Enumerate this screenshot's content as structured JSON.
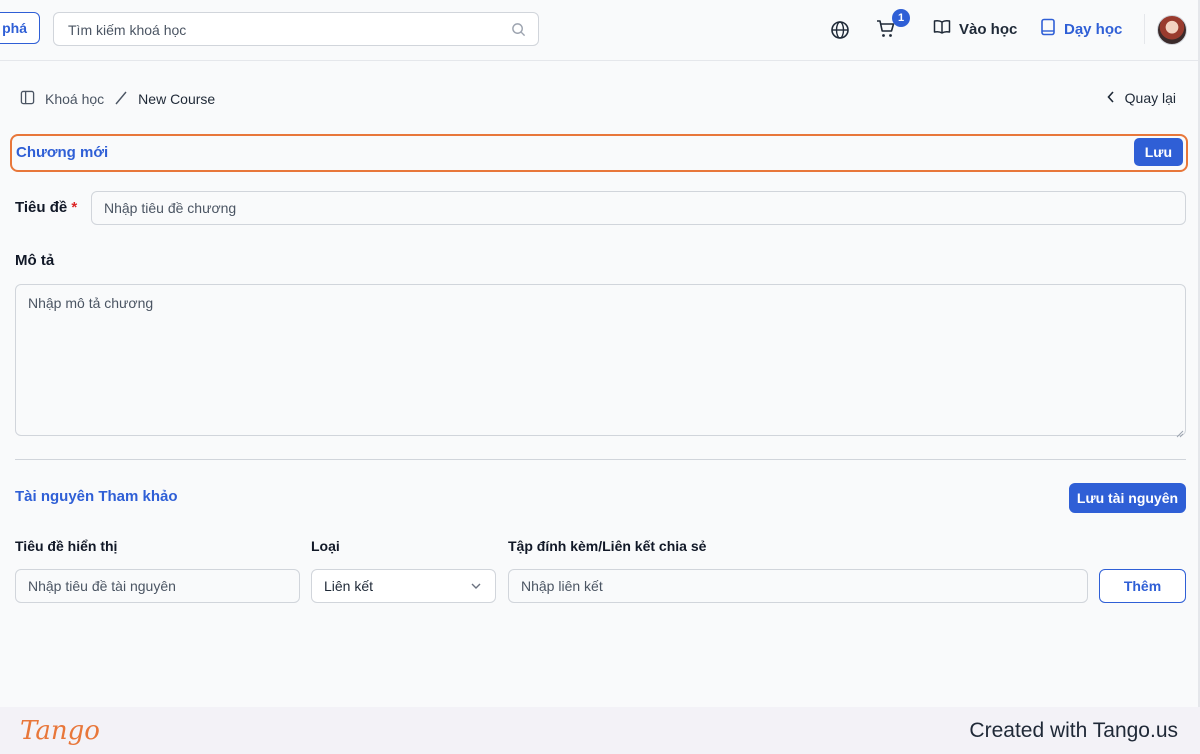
{
  "header": {
    "explore_label": "phá",
    "search_placeholder": "Tìm kiếm khoá học",
    "cart_count": "1",
    "learn_label": "Vào học",
    "teach_label": "Dạy học"
  },
  "breadcrumb": {
    "courses": "Khoá học",
    "current": "New Course",
    "back_label": "Quay lại"
  },
  "chapter": {
    "title": "Chương mới",
    "save_label": "Lưu",
    "title_label": "Tiêu đề",
    "required_mark": "*",
    "title_placeholder": "Nhập tiêu đề chương",
    "description_label": "Mô tả",
    "description_placeholder": "Nhập mô tả chương"
  },
  "resources": {
    "section_title": "Tài nguyên Tham khảo",
    "save_label": "Lưu tài nguyên",
    "col_display_title": "Tiêu đề hiển thị",
    "col_type": "Loại",
    "col_attachment": "Tập đính kèm/Liên kết chia sẻ",
    "display_title_placeholder": "Nhập tiêu đề tài nguyên",
    "type_selected": "Liên kết",
    "link_placeholder": "Nhập liên kết",
    "add_label": "Thêm"
  },
  "footer": {
    "logo_text": "Tango",
    "created_text": "Created with Tango.us"
  },
  "colors": {
    "primary": "#2f5fd6",
    "highlight": "#e8773a",
    "required": "#dc2626"
  }
}
